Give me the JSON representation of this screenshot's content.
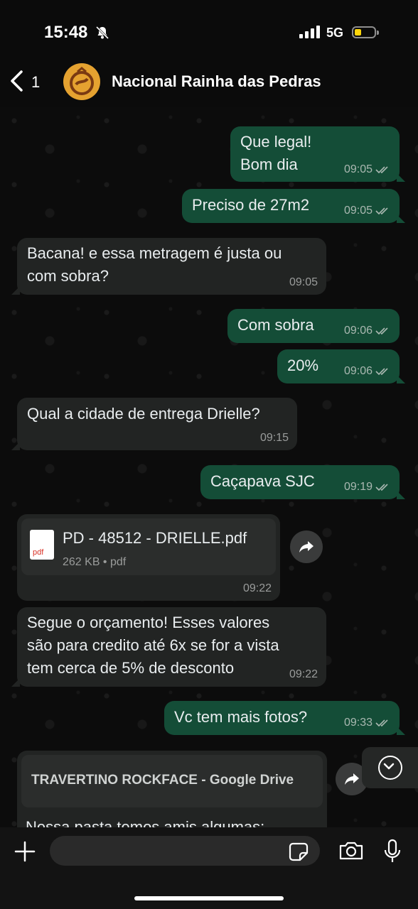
{
  "status_bar": {
    "time": "15:48",
    "network": "5G"
  },
  "header": {
    "back_count": "1",
    "contact_name": "Nacional Rainha das Pedras"
  },
  "messages": [
    {
      "text": "Que legal!\nBom dia",
      "time": "09:05"
    },
    {
      "text": "Preciso de 27m2",
      "time": "09:05"
    },
    {
      "text": "Bacana! e essa metragem é justa ou\ncom sobra?",
      "time": "09:05"
    },
    {
      "text": "Com sobra",
      "time": "09:06"
    },
    {
      "text": "20%",
      "time": "09:06"
    },
    {
      "text": "Qual a cidade de entrega Drielle?",
      "time": "09:15"
    },
    {
      "text": "Caçapava SJC",
      "time": "09:19"
    },
    {
      "file_name": "PD - 48512 - DRIELLE.pdf",
      "file_meta": "262 KB • pdf",
      "pdf_label": "pdf",
      "time": "09:22"
    },
    {
      "text": "Segue o orçamento! Esses valores\nsão para credito até 6x se for a vista\ntem cerca de 5% de desconto",
      "time": "09:22"
    },
    {
      "text": "Vc tem mais fotos?",
      "time": "09:33"
    },
    {
      "link_title": "TRAVERTINO ROCKFACE - Google Drive",
      "text": "Nessa pasta temos amis algumas:"
    }
  ],
  "colors": {
    "outgoing": "#144d37",
    "incoming": "#222423",
    "accent_battery": "#ffd60a"
  }
}
